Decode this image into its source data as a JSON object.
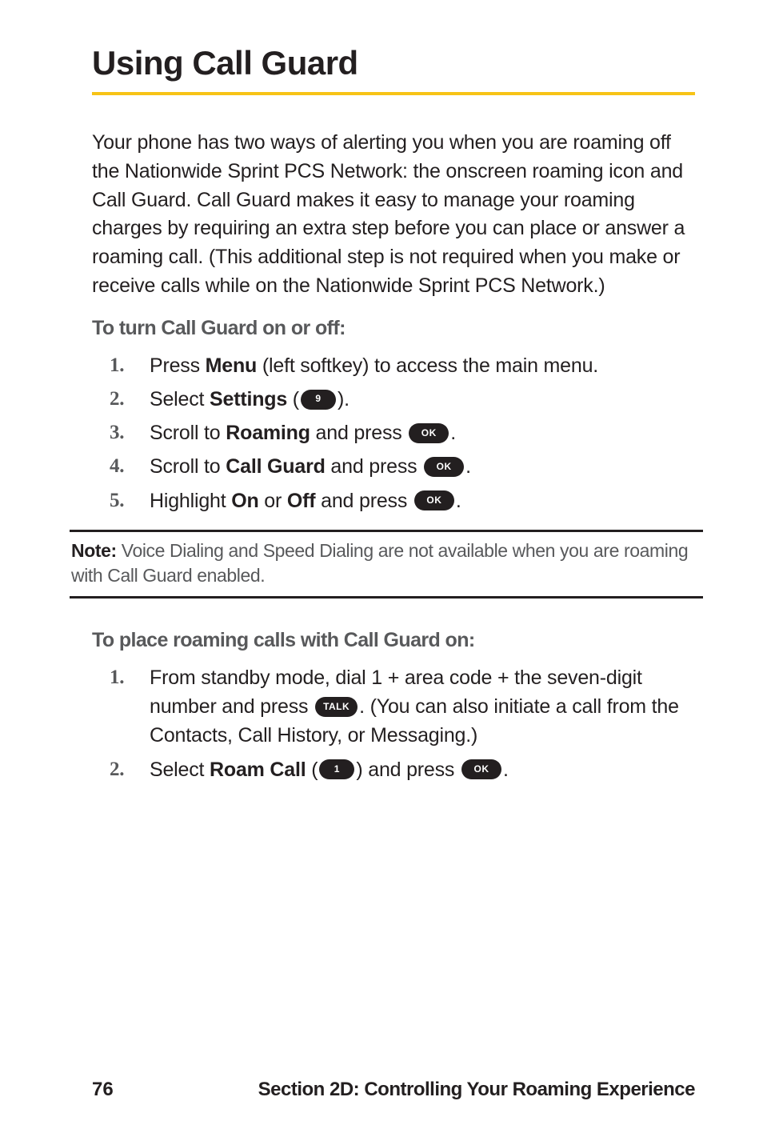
{
  "heading": "Using Call Guard",
  "intro_para": "Your phone has two ways of alerting you when you are roaming off the Nationwide Sprint PCS Network: the onscreen roaming icon and Call Guard. Call Guard makes it easy to manage your roaming charges by requiring an extra step before you can place or answer a roaming call. (This additional step is not required when you make or receive calls while on the Nationwide Sprint PCS Network.)",
  "sub1": "To turn Call Guard on or off:",
  "steps1": {
    "s1_a": "Press ",
    "s1_b": "Menu",
    "s1_c": " (left softkey) to access the main menu.",
    "s2_a": "Select ",
    "s2_b": "Settings",
    "s2_c": " (",
    "s2_d": ").",
    "s3_a": "Scroll to ",
    "s3_b": "Roaming",
    "s3_c": " and press ",
    "s3_d": ".",
    "s4_a": "Scroll to ",
    "s4_b": "Call Guard",
    "s4_c": " and press ",
    "s4_d": ".",
    "s5_a": "Highlight ",
    "s5_b": "On",
    "s5_c": " or ",
    "s5_d": "Off",
    "s5_e": " and press ",
    "s5_f": "."
  },
  "nums": {
    "n1": "1.",
    "n2": "2.",
    "n3": "3.",
    "n4": "4.",
    "n5": "5."
  },
  "pills": {
    "nine": "9",
    "ok": "OK",
    "talk": "TALK",
    "one": "1"
  },
  "note_label": "Note:",
  "note_body": " Voice Dialing and Speed Dialing are not available when you are roaming with Call Guard enabled.",
  "sub2": "To place roaming calls with Call Guard on:",
  "steps2": {
    "s1_a": "From standby mode, dial 1 + area code + the seven-digit number and press ",
    "s1_b": ". (You can also initiate a call from the Contacts, Call History, or Messaging.)",
    "s2_a": "Select ",
    "s2_b": "Roam Call",
    "s2_c": " (",
    "s2_d": ") and press ",
    "s2_e": "."
  },
  "footer": {
    "page": "76",
    "section": "Section 2D: Controlling Your Roaming Experience"
  }
}
